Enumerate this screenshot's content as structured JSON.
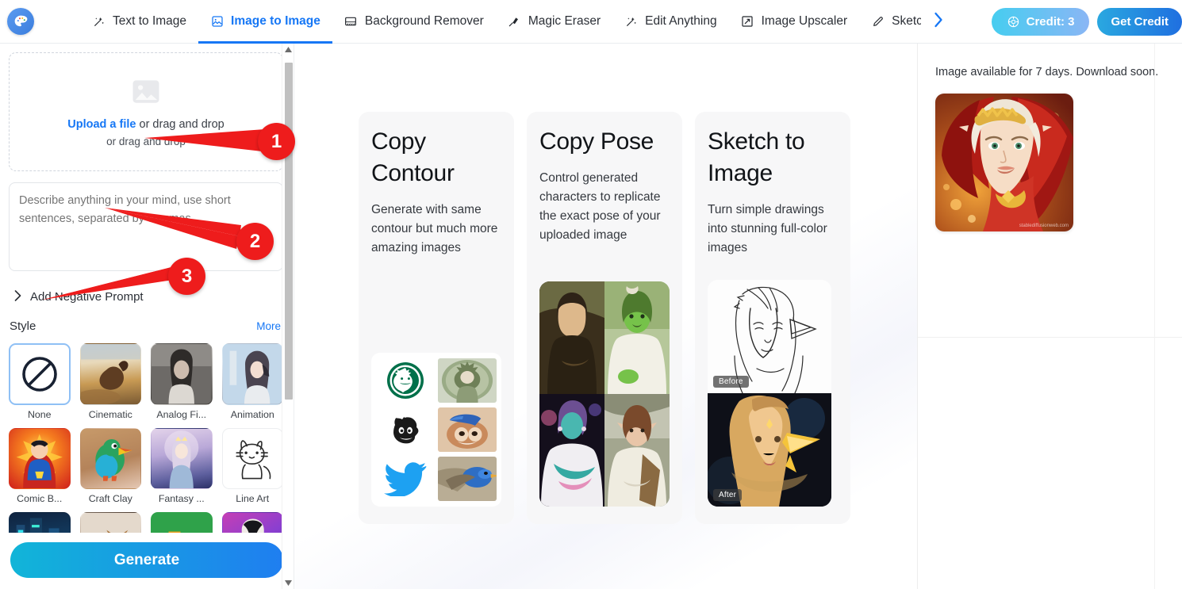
{
  "app": {
    "logo_icon": "palette-icon"
  },
  "header": {
    "tabs": [
      {
        "label": "Text to Image",
        "icon": "magic-wand-icon",
        "active": false
      },
      {
        "label": "Image to Image",
        "icon": "image-frame-icon",
        "active": true
      },
      {
        "label": "Background Remover",
        "icon": "background-remove-icon",
        "active": false
      },
      {
        "label": "Magic Eraser",
        "icon": "eraser-brush-icon",
        "active": false
      },
      {
        "label": "Edit Anything",
        "icon": "magic-wand-icon",
        "active": false
      },
      {
        "label": "Image Upscaler",
        "icon": "expand-arrow-icon",
        "active": false
      },
      {
        "label": "Sketch",
        "icon": "pencil-icon",
        "active": false
      }
    ],
    "next_arrow_icon": "chevron-right-icon",
    "credit_label": "Credit: 3",
    "credit_icon": "credit-token-icon",
    "get_credit_label": "Get Credit",
    "accent_color": "#1677f5"
  },
  "sidebar": {
    "upload": {
      "icon": "image-placeholder-icon",
      "link_text": "Upload a file",
      "line1_rest": " or drag and drop",
      "line2": "or drag and drop"
    },
    "prompt": {
      "placeholder": "Describe anything in your mind, use short sentences, separated by commas.",
      "value": ""
    },
    "negative_prompt": {
      "label": "Add Negative Prompt",
      "chevron_icon": "chevron-right-icon"
    },
    "style": {
      "label": "Style",
      "more_label": "More",
      "items": [
        {
          "label": "None",
          "selected": true,
          "icon": "no-style-icon"
        },
        {
          "label": "Cinematic",
          "selected": false,
          "icon": "cinematic-thumb"
        },
        {
          "label": "Analog Fi...",
          "selected": false,
          "icon": "analog-film-thumb"
        },
        {
          "label": "Animation",
          "selected": false,
          "icon": "animation-thumb"
        },
        {
          "label": "Comic B...",
          "selected": false,
          "icon": "comic-book-thumb"
        },
        {
          "label": "Craft Clay",
          "selected": false,
          "icon": "craft-clay-thumb"
        },
        {
          "label": "Fantasy ...",
          "selected": false,
          "icon": "fantasy-art-thumb"
        },
        {
          "label": "Line Art",
          "selected": false,
          "icon": "line-art-thumb"
        },
        {
          "label": "",
          "selected": false,
          "icon": "neon-punk-thumb"
        },
        {
          "label": "",
          "selected": false,
          "icon": "photographic-thumb"
        },
        {
          "label": "",
          "selected": false,
          "icon": "pixel-art-thumb"
        },
        {
          "label": "",
          "selected": false,
          "icon": "digital-art-thumb"
        }
      ]
    },
    "generate_label": "Generate",
    "scrollbar": {
      "up_icon": "caret-up-icon",
      "down_icon": "caret-down-icon"
    }
  },
  "main": {
    "cards": [
      {
        "title": "Copy Contour",
        "desc": "Generate with same contour but much more amazing images",
        "art": "contour-logo-grid",
        "thumbs": [
          {
            "name": "starbucks-logo-icon"
          },
          {
            "name": "starbucks-generated-thumb"
          },
          {
            "name": "mailchimp-logo-icon"
          },
          {
            "name": "mailchimp-generated-thumb"
          },
          {
            "name": "twitter-logo-icon"
          },
          {
            "name": "twitter-generated-thumb"
          }
        ]
      },
      {
        "title": "Copy Pose",
        "desc": "Control generated characters to replicate the exact pose of your uploaded image",
        "art": "pose-grid",
        "thumbs": [
          {
            "name": "mona-lisa-thumb"
          },
          {
            "name": "green-character-thumb"
          },
          {
            "name": "stylized-woman-thumb"
          },
          {
            "name": "elf-woman-thumb"
          }
        ]
      },
      {
        "title": "Sketch to Image",
        "desc": "Turn simple drawings into stunning full-color images",
        "art": "before-after",
        "before_label": "Before",
        "after_label": "After"
      }
    ]
  },
  "right_panel": {
    "availability_text": "Image available for 7 days. Download soon.",
    "result_image_name": "generated-elf-portrait",
    "watermark": "stablediffusionweb.com"
  },
  "annotations": [
    {
      "number": "1",
      "target": "upload-dropzone"
    },
    {
      "number": "2",
      "target": "prompt-textarea"
    },
    {
      "number": "3",
      "target": "style-section"
    }
  ]
}
